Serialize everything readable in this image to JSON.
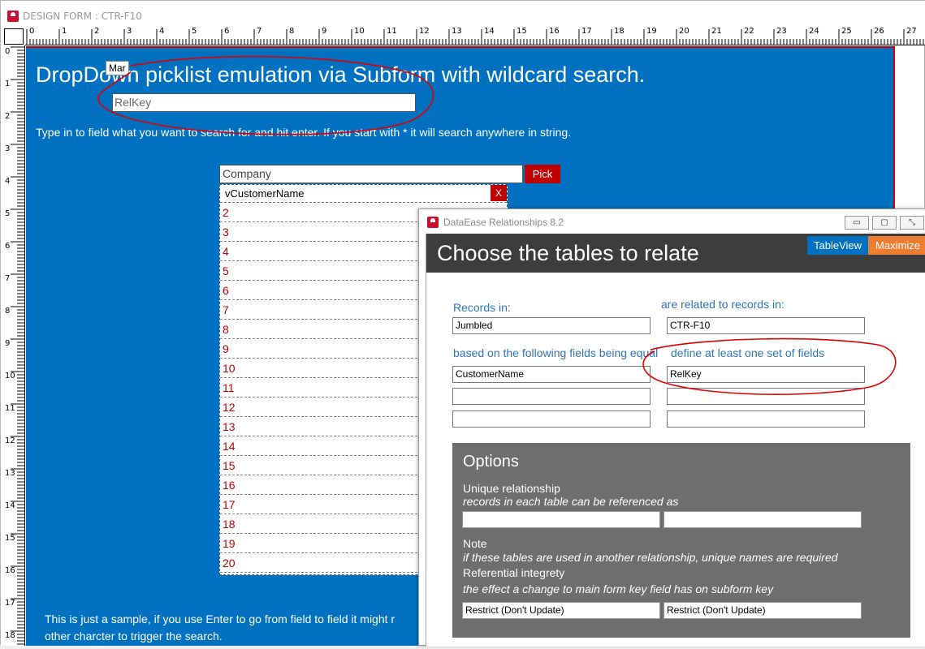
{
  "design_window": {
    "title": "DESIGN FORM : CTR-F10"
  },
  "ruler": {
    "h_ticks": [
      "0",
      "1",
      "2",
      "3",
      "4",
      "5",
      "6",
      "7",
      "8",
      "9",
      "10",
      "11",
      "12",
      "13",
      "14",
      "15",
      "16",
      "17",
      "18",
      "19",
      "20",
      "21",
      "22",
      "23",
      "24",
      "25",
      "26",
      "27"
    ],
    "v_ticks": [
      "0",
      "1",
      "2",
      "3",
      "4",
      "5",
      "6",
      "7",
      "8",
      "9",
      "10",
      "11",
      "12",
      "13",
      "14",
      "15",
      "16",
      "17",
      "18"
    ]
  },
  "form": {
    "title": "DropDown picklist emulation via Subform with wildcard search.",
    "tooltip": "Mar",
    "relkey_field": "RelKey",
    "instruction": "Type in to field what you want to search for and hit enter. If you start with * it will search anywhere in string.",
    "company_field": "Company",
    "pick_label": "Pick",
    "subform_header": "vCustomerName",
    "close_label": "X",
    "row_numbers": [
      "2",
      "3",
      "4",
      "5",
      "6",
      "7",
      "8",
      "9",
      "10",
      "11",
      "12",
      "13",
      "14",
      "15",
      "16",
      "17",
      "18",
      "19",
      "20"
    ],
    "footer_line1": "This is just a sample, if you use Enter to go from field to field it might r",
    "footer_line2": "other charcter to trigger the search."
  },
  "rel_dialog": {
    "title": "DataEase Relationships 8.2",
    "minimize_label": "▭",
    "restore_label": "▢",
    "close_label": "⤡",
    "heading": "Choose the tables to relate",
    "tableview_label": "TableView",
    "maximize_label": "Maximize",
    "records_in_label": "Records in:",
    "related_label": "are related to records in:",
    "records_in_value": "Jumbled",
    "related_value": "CTR-F10",
    "based_on_label": "based on the following fields being equal",
    "define_label": "define at least one set of fields",
    "left_field_1": "CustomerName",
    "right_field_1": "RelKey",
    "left_field_2": "",
    "right_field_2": "",
    "left_field_3": "",
    "right_field_3": "",
    "options": {
      "title": "Options",
      "unique_label": "Unique relationship",
      "unique_note": "records in each table can be referenced as",
      "unique_left": "",
      "unique_right": "",
      "note_label": "Note",
      "note_text": "if these tables are used in another relationship, unique names are required",
      "ref_label": "Referential integrety",
      "ref_note": "the effect a change to main form key field has on subform key",
      "ref_left": "Restrict (Don't Update)",
      "ref_right": "Restrict (Don't Update)"
    }
  },
  "colors": {
    "canvas_blue": "#0070c0",
    "accent_red": "#c00000",
    "label_blue": "#2e75b6",
    "maximize_orange": "#ed7d31",
    "options_gray": "#6e6e6e",
    "header_dark": "#3c3c3c"
  }
}
